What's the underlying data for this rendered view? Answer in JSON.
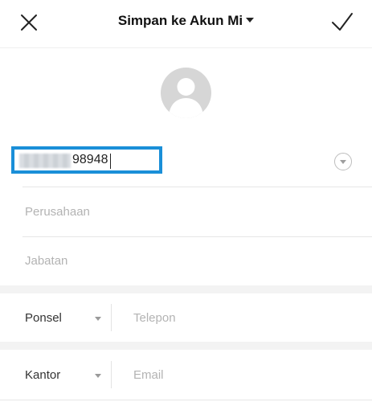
{
  "header": {
    "title": "Simpan ke Akun Mi",
    "close_icon": "close-icon",
    "confirm_icon": "checkmark-icon"
  },
  "contact": {
    "avatar_icon": "avatar-placeholder-icon",
    "name_value": "98948",
    "company_placeholder": "Perusahaan",
    "title_placeholder": "Jabatan"
  },
  "phone": {
    "type_label": "Ponsel",
    "placeholder": "Telepon"
  },
  "email": {
    "type_label": "Kantor",
    "placeholder": "Email"
  },
  "colors": {
    "highlight": "#1a8fd8",
    "placeholder": "#b3b3b3",
    "divider": "#e6e6e6"
  }
}
